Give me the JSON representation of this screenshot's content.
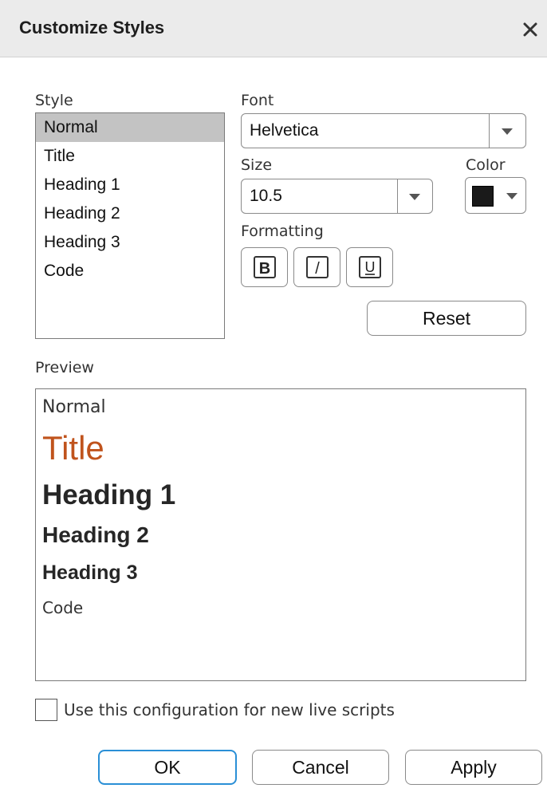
{
  "dialog": {
    "title": "Customize Styles",
    "close_icon": "close-icon"
  },
  "style_panel": {
    "label": "Style",
    "items": [
      "Normal",
      "Title",
      "Heading 1",
      "Heading 2",
      "Heading 3",
      "Code"
    ],
    "selected": "Normal"
  },
  "font": {
    "label": "Font",
    "value": "Helvetica",
    "dropdown_icon": "chevron-down-icon"
  },
  "size": {
    "label": "Size",
    "value": "10.5",
    "dropdown_icon": "chevron-down-icon"
  },
  "color": {
    "label": "Color",
    "swatch": "#1a1a1a",
    "dropdown_icon": "chevron-down-icon"
  },
  "formatting": {
    "label": "Formatting",
    "bold_glyph": "B",
    "italic_glyph": "/",
    "underline_glyph": "U",
    "bold_icon": "bold-icon",
    "italic_icon": "italic-icon",
    "underline_icon": "underline-icon"
  },
  "reset_label": "Reset",
  "preview": {
    "label": "Preview",
    "normal": "Normal",
    "title": "Title",
    "heading1": "Heading 1",
    "heading2": "Heading 2",
    "heading3": "Heading 3",
    "code": "Code",
    "title_color": "#c0531c"
  },
  "checkbox": {
    "label": "Use this configuration for new live scripts",
    "checked": false
  },
  "buttons": {
    "ok": "OK",
    "cancel": "Cancel",
    "apply": "Apply"
  },
  "colors": {
    "titlebar": "#ebebeb",
    "selection": "#c3c3c3",
    "focus_border": "#2a8fd6"
  }
}
